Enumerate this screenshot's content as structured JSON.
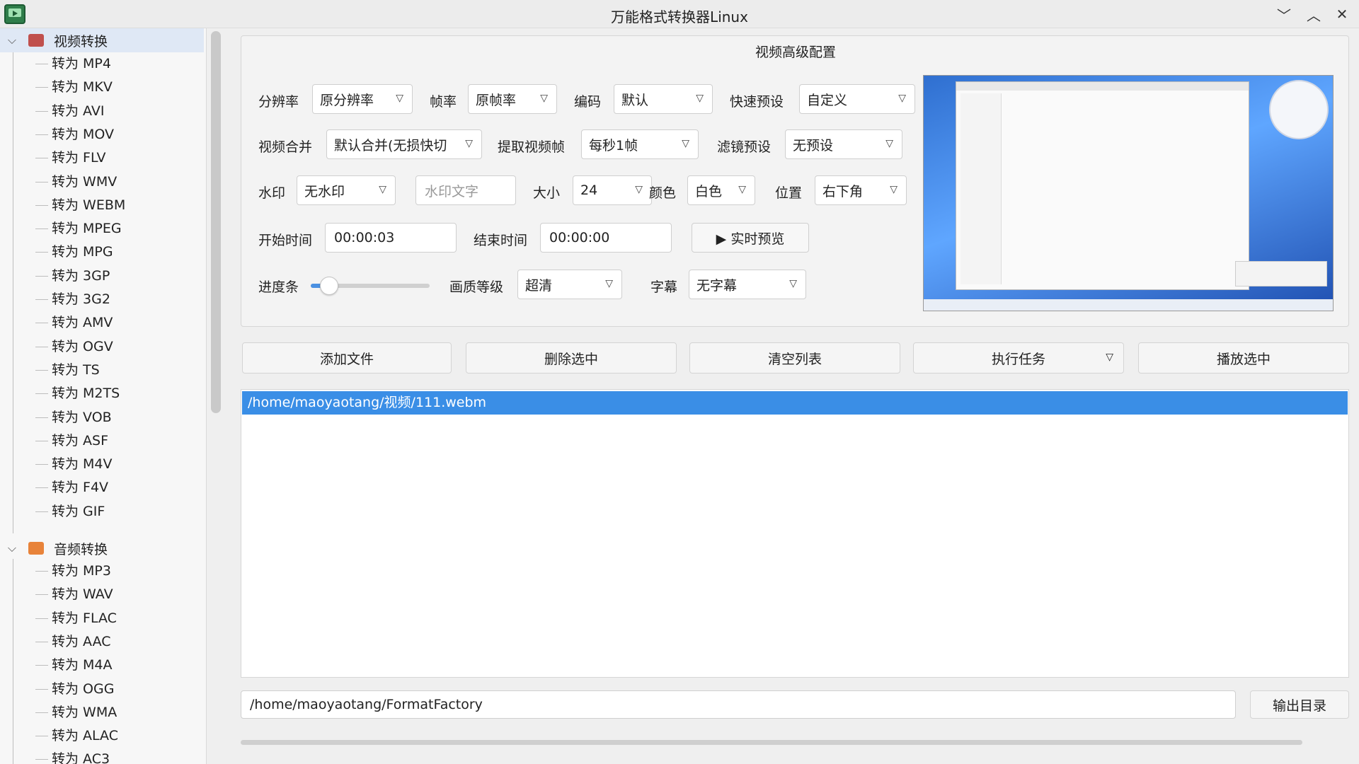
{
  "window": {
    "title": "万能格式转换器Linux"
  },
  "sidebar": {
    "video_group": {
      "label": "视频转换",
      "items": [
        "转为 MP4",
        "转为 MKV",
        "转为 AVI",
        "转为 MOV",
        "转为 FLV",
        "转为 WMV",
        "转为 WEBM",
        "转为 MPEG",
        "转为 MPG",
        "转为 3GP",
        "转为 3G2",
        "转为 AMV",
        "转为 OGV",
        "转为 TS",
        "转为 M2TS",
        "转为 VOB",
        "转为 ASF",
        "转为 M4V",
        "转为 F4V",
        "转为 GIF"
      ]
    },
    "audio_group": {
      "label": "音频转换",
      "items": [
        "转为 MP3",
        "转为 WAV",
        "转为 FLAC",
        "转为 AAC",
        "转为 M4A",
        "转为 OGG",
        "转为 WMA",
        "转为 ALAC",
        "转为 AC3"
      ]
    }
  },
  "config": {
    "title": "视频高级配置",
    "resolution": {
      "label": "分辨率",
      "value": "原分辨率"
    },
    "framerate": {
      "label": "帧率",
      "value": "原帧率"
    },
    "codec": {
      "label": "编码",
      "value": "默认"
    },
    "preset": {
      "label": "快速预设",
      "value": "自定义"
    },
    "merge": {
      "label": "视频合并",
      "value": "默认合并(无损快切"
    },
    "extract": {
      "label": "提取视频帧",
      "value": "每秒1帧"
    },
    "filter": {
      "label": "滤镜预设",
      "value": "无预设"
    },
    "watermark": {
      "label": "水印",
      "value": "无水印",
      "text_placeholder": "水印文字"
    },
    "size": {
      "label": "大小",
      "value": "24"
    },
    "color": {
      "label": "颜色",
      "value": "白色"
    },
    "position": {
      "label": "位置",
      "value": "右下角"
    },
    "start": {
      "label": "开始时间",
      "value": "00:00:03"
    },
    "end": {
      "label": "结束时间",
      "value": "00:00:00"
    },
    "preview_btn": "▶ 实时预览",
    "progress": {
      "label": "进度条",
      "fraction": 0.1
    },
    "quality": {
      "label": "画质等级",
      "value": "超清"
    },
    "subtitle": {
      "label": "字幕",
      "value": "无字幕"
    }
  },
  "actions": {
    "add": "添加文件",
    "delete": "删除选中",
    "clear": "清空列表",
    "run": "执行任务",
    "play": "播放选中"
  },
  "files": [
    "/home/maoyaotang/视频/111.webm"
  ],
  "output": {
    "path": "/home/maoyaotang/FormatFactory",
    "button": "输出目录"
  },
  "colors": {
    "selection": "#3a8ee6",
    "accent": "#4a90e2"
  }
}
